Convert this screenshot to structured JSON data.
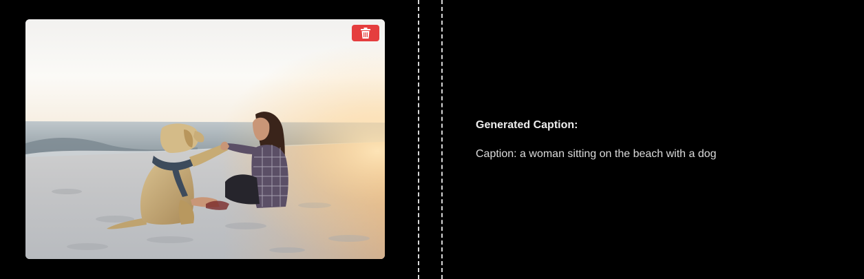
{
  "image_panel": {
    "delete_icon": "trash-icon",
    "delete_button_color": "#e53e3e"
  },
  "caption": {
    "heading": "Generated Caption:",
    "text": "Caption: a woman sitting on the beach with a dog"
  },
  "theme": {
    "background": "#000000",
    "divider_color": "#d9d9d9"
  }
}
